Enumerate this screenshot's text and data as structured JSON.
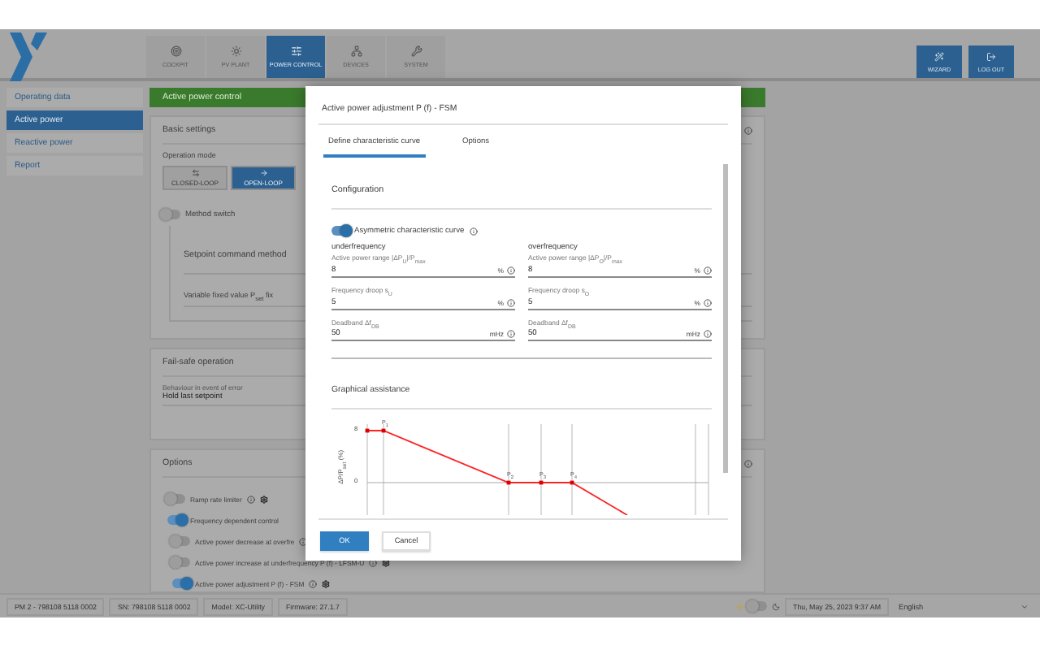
{
  "header": {
    "nav": [
      {
        "label": "COCKPIT",
        "selected": false
      },
      {
        "label": "PV PLANT",
        "selected": false
      },
      {
        "label": "POWER CONTROL",
        "selected": true
      },
      {
        "label": "DEVICES",
        "selected": false
      },
      {
        "label": "SYSTEM",
        "selected": false
      }
    ],
    "actions": [
      {
        "label": "WIZARD"
      },
      {
        "label": "LOG OUT"
      }
    ]
  },
  "sidebar": {
    "items": [
      {
        "label": "Operating data",
        "selected": false
      },
      {
        "label": "Active power",
        "selected": true
      },
      {
        "label": "Reactive power",
        "selected": false
      },
      {
        "label": "Report",
        "selected": false
      }
    ]
  },
  "main": {
    "title": "Active power control",
    "basic_settings": {
      "title": "Basic settings",
      "operation_mode_label": "Operation mode",
      "modes": [
        {
          "label": "CLOSED-LOOP",
          "selected": false
        },
        {
          "label": "OPEN-LOOP",
          "selected": true
        }
      ],
      "method_switch": {
        "label": "Method switch",
        "on": false
      },
      "setpoint_title": "Setpoint command method",
      "setpoint_value": "Variable fixed value P$_{set}$ fix"
    },
    "fail_safe": {
      "title": "Fail-safe operation",
      "field_label": "Behaviour in event of error",
      "field_value": "Hold last setpoint"
    },
    "options": {
      "title": "Options",
      "toggles": [
        {
          "label": "Ramp rate limiter",
          "on": false
        },
        {
          "label": "Frequency dependent control",
          "on": true,
          "children": [
            {
              "label": "Active power decrease at overfre",
              "on": false
            },
            {
              "label": "Active power increase at underfrequency P (f) - LFSM-U",
              "on": false
            },
            {
              "label": "Active power adjustment P (f) - FSM",
              "on": true
            }
          ]
        }
      ]
    }
  },
  "dialog": {
    "title": "Active power adjustment P (f) - FSM",
    "tabs": [
      {
        "label": "Define characteristic curve",
        "selected": true
      },
      {
        "label": "Options",
        "selected": false
      }
    ],
    "configuration": {
      "title": "Configuration",
      "asymmetric": {
        "label": "Asymmetric characteristic curve",
        "on": true
      },
      "columns": [
        {
          "heading": "underfrequency",
          "fields": [
            {
              "label": "Active power range |ΔP$_{U}$|/P$_{max}$",
              "value": "8",
              "unit": "%"
            },
            {
              "label": "Frequency droop s$_{U}$",
              "value": "5",
              "unit": "%"
            },
            {
              "label": "Deadband Δf$_{DB}$",
              "value": "50",
              "unit": "mHz"
            }
          ]
        },
        {
          "heading": "overfrequency",
          "fields": [
            {
              "label": "Active power range |ΔP$_{O}$|/P$_{max}$",
              "value": "8",
              "unit": "%"
            },
            {
              "label": "Frequency droop s$_{O}$",
              "value": "5",
              "unit": "%"
            },
            {
              "label": "Deadband Δf$_{DB}$",
              "value": "50",
              "unit": "mHz"
            }
          ]
        }
      ]
    },
    "graphical": {
      "title": "Graphical assistance",
      "ylabel": "ΔP/P$_{set}$ (%)",
      "yticks": [
        "8",
        "0"
      ],
      "point_labels": [
        "P$_{1}$",
        "P$_{2}$",
        "P$_{3}$",
        "P$_{4}$"
      ]
    },
    "buttons": [
      {
        "label": "OK",
        "primary": true
      },
      {
        "label": "Cancel",
        "primary": false
      }
    ]
  },
  "status_bar": {
    "items": [
      "PM 2 - 798108 5118 0002",
      "SN: 798108 5118 0002",
      "Model: XC-Utility",
      "Firmware: 27.1.7"
    ],
    "dark_mode": false,
    "datetime": "Thu, May 25, 2023 9:37 AM",
    "language": "English"
  }
}
